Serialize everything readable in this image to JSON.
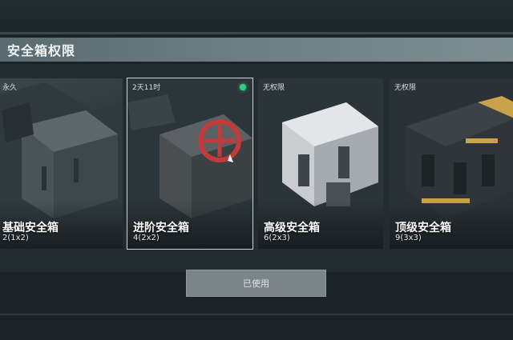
{
  "header": {
    "title": "安全箱权限"
  },
  "cards": [
    {
      "tag": "永久",
      "name": "基础安全箱",
      "size": "2(1x2)",
      "selected": false
    },
    {
      "tag": "2天11时",
      "name": "进阶安全箱",
      "size": "4(2x2)",
      "selected": true
    },
    {
      "tag": "无权限",
      "name": "高级安全箱",
      "size": "6(2x3)",
      "selected": false
    },
    {
      "tag": "无权限",
      "name": "顶级安全箱",
      "size": "9(3x3)",
      "selected": false
    }
  ],
  "action": {
    "label": "已使用"
  },
  "colors": {
    "status_active": "#2ed27a",
    "accent_red": "#c23a3a",
    "gold_trim": "#c9a24a"
  }
}
